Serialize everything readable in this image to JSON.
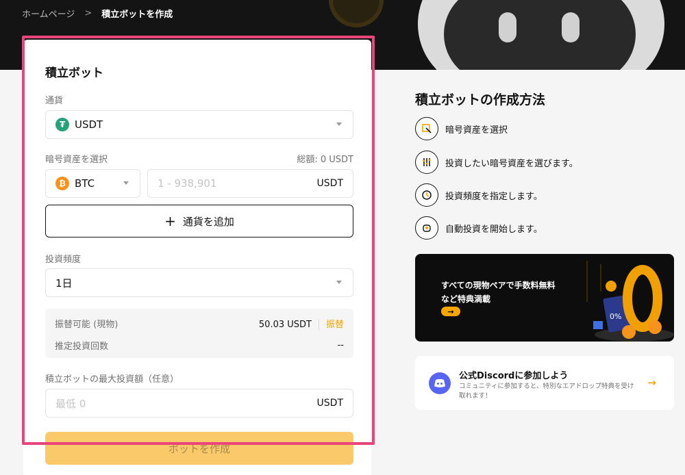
{
  "breadcrumb": {
    "home": "ホームページ",
    "separator": ">",
    "current": "積立ボットを作成"
  },
  "form": {
    "title": "積立ボット",
    "currency_label": "通貨",
    "currency_value": "USDT",
    "asset_label": "暗号資産を選択",
    "total_label": "総額: 0 USDT",
    "asset_value": "BTC",
    "amount_placeholder": "1 - 938,901",
    "amount_unit": "USDT",
    "add_currency_label": "通貨を追加",
    "add_currency_icon": "+",
    "frequency_label": "投資頻度",
    "frequency_value": "1日",
    "available_label": "振替可能 (現物)",
    "available_value": "50.03 USDT",
    "transfer_label": "振替",
    "estimate_label": "推定投資回数",
    "estimate_value": "--",
    "max_label": "積立ボットの最大投資額（任意）",
    "max_placeholder": "最低 0",
    "max_unit": "USDT",
    "submit_label": "ボットを作成"
  },
  "guide": {
    "title": "積立ボットの作成方法",
    "steps": [
      {
        "label": "暗号資産を選択",
        "icon": "select-icon"
      },
      {
        "label": "投資したい暗号資産を選びます。",
        "icon": "sliders-icon"
      },
      {
        "label": "投資頻度を指定します。",
        "icon": "clock-icon"
      },
      {
        "label": "自動投資を開始します。",
        "icon": "bot-icon"
      }
    ]
  },
  "promo": {
    "line1": "すべての現物ペアで手数料無料",
    "line2": "など特典満載",
    "arrow": "→",
    "badge": "0%"
  },
  "discord": {
    "title": "公式Discordに参加しよう",
    "subtitle": "コミュニティに参加すると、特別なエアドロップ特典を受け取れます！",
    "arrow": "→"
  },
  "colors": {
    "accent": "#f7a600",
    "highlight": "#e8457b",
    "usdt": "#26a17b",
    "btc": "#f7931a",
    "discord": "#5865f2"
  }
}
